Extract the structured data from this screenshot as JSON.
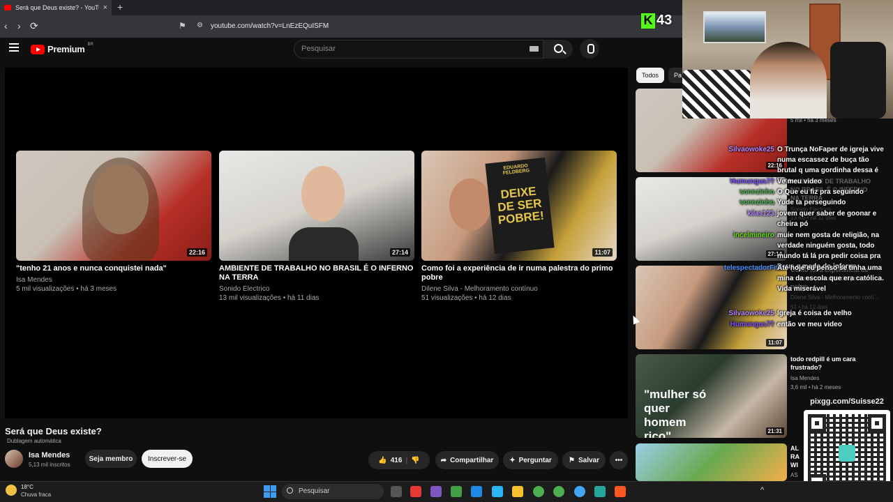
{
  "browser": {
    "tab_title": "Será que Deus existe? - YouTube",
    "tab_close": "×",
    "new_tab": "+",
    "url": "youtube.com/watch?v=LnEzEQuISFM",
    "nav": {
      "back": "‹",
      "forward": "›",
      "reload": "⟳"
    },
    "bookmark_icon": "bookmark-icon",
    "site_icon": "site-info-icon"
  },
  "youtube": {
    "logo_text": "Premium",
    "logo_region": "BR",
    "search_placeholder": "Pesquisar",
    "icons": [
      "menu-icon",
      "search-icon",
      "mic-icon",
      "keyboard-icon"
    ]
  },
  "endscreen": {
    "cards": [
      {
        "title": "\"tenho 21 anos e nunca conquistei nada\"",
        "channel": "Isa Mendes",
        "meta": "5 mil visualizações • há 3 meses",
        "duration": "22:16"
      },
      {
        "title": "AMBIENTE DE TRABALHO NO BRASIL É O INFERNO NA TERRA",
        "channel": "Sonido Electrico",
        "meta": "13 mil visualizações • há 11 dias",
        "duration": "27:14"
      },
      {
        "title": "Como foi a experiência de ir numa palestra do primo pobre",
        "channel": "Dilene Silva - Melhoramento contínuo",
        "meta": "51 visualizações • há 12 dias",
        "duration": "11:07"
      }
    ],
    "book_text": {
      "author": "EDUARDO FELDBERG",
      "title": "DEIXE DE SER POBRE!"
    }
  },
  "video": {
    "title": "Será que Deus existe?",
    "dubbing": "Dublagem automática",
    "channel": "Isa Mendes",
    "subscribers": "5,13 mil inscritos",
    "join_label": "Seja membro",
    "subscribe_label": "Inscrever-se",
    "likes": "416",
    "share_label": "Compartilhar",
    "ask_label": "Perguntar",
    "save_label": "Salvar",
    "more_label": "•••"
  },
  "sidebar": {
    "chips": [
      "Todos",
      "Pa"
    ],
    "items": [
      {
        "duration": "22:16",
        "meta": "5 mil • há 3 meses"
      },
      {
        "duration": "27:14",
        "title": "AMBIENTE DE TRABALHO NO BRASIL É O INFERNO NA TERRA",
        "channel": "Sonido Electrico",
        "meta": "13 mil • há 11 dias"
      },
      {
        "duration": "11:07",
        "title": "Como foi a experiência de ir numa palestra do primo pobre",
        "channel": "Dilene Silva - Melhoramento contí...",
        "meta": "51 • há 12 dias"
      },
      {
        "duration": "",
        "title": "todo redpill é um cara frustrado?",
        "channel": "Isa Mendes",
        "meta": "3,6 mil • há 2 meses",
        "thumb_text": "\"mulher só quer homem rico\""
      },
      {
        "duration": "21:31",
        "title": "AL RA WI",
        "meta": "AS"
      }
    ]
  },
  "stream": {
    "platform_logo": "K",
    "viewer_count": "43",
    "pix_label": "pixgg.com/Suisse22",
    "chat": [
      {
        "user": "Silvaowoke25",
        "color": "#b388ff",
        "text": "O Trunça NoFaper de igreja vive numa escassez de buça tão brutal q uma gordinha dessa é luxo"
      },
      {
        "user": "Humungus77",
        "color": "#7c4dff",
        "text": "Ve meu video"
      },
      {
        "user": "sonnzinho",
        "color": "#4caf50",
        "text": "O Que eu fiz pra seguindo"
      },
      {
        "user": "sonnzinho",
        "color": "#4caf50",
        "text": "Yude ta perseguindo"
      },
      {
        "user": "kilas123",
        "color": "#b388ff",
        "text": "jovem quer saber de goonar e cheira pó"
      },
      {
        "user": "incelmineiro",
        "color": "#64dd17",
        "text": "muie nem gosta de religião, na verdade ninguém gosta, todo mundo tá lá pra pedir coisa pra Deus e medo do inferno"
      },
      {
        "user": "telespectadorFitoP",
        "color": "#448aff",
        "text": "Até hoje eu penso se tinha uma mina da escola que era católica. Vida miserável"
      },
      {
        "user": "Silvaowoke25",
        "color": "#b388ff",
        "text": "Igreja é coisa de velho"
      },
      {
        "user": "Humungus77",
        "color": "#7c4dff",
        "text": "então ve meu video"
      }
    ]
  },
  "taskbar": {
    "temp": "18°C",
    "weather": "Chuva fraca",
    "search_label": "Pesquisar",
    "tray": "^"
  }
}
